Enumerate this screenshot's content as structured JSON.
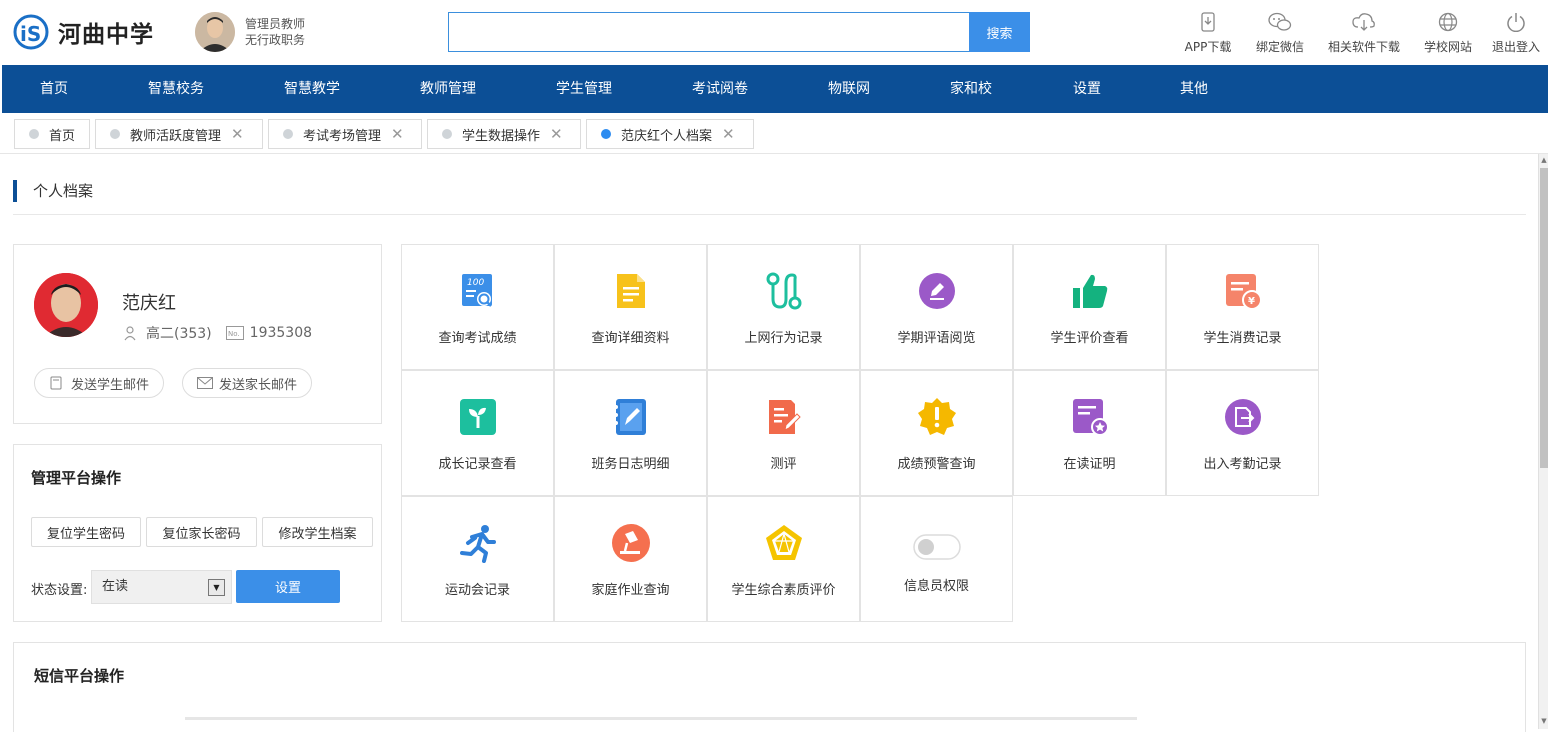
{
  "header": {
    "school_name": "河曲中学",
    "user_role": "管理员教师",
    "user_position": "无行政职务",
    "search_placeholder": "",
    "search_button": "搜索",
    "tools": [
      {
        "label": "APP下载",
        "icon": "phone-download-icon"
      },
      {
        "label": "绑定微信",
        "icon": "wechat-icon"
      },
      {
        "label": "相关软件下载",
        "icon": "cloud-download-icon"
      },
      {
        "label": "学校网站",
        "icon": "globe-icon"
      },
      {
        "label": "退出登入",
        "icon": "power-icon"
      }
    ]
  },
  "nav": [
    "首页",
    "智慧校务",
    "智慧教学",
    "教师管理",
    "学生管理",
    "考试阅卷",
    "物联网",
    "家和校",
    "设置",
    "其他"
  ],
  "tabs": [
    {
      "label": "首页",
      "closable": false,
      "active": false
    },
    {
      "label": "教师活跃度管理",
      "closable": true,
      "active": false
    },
    {
      "label": "考试考场管理",
      "closable": true,
      "active": false
    },
    {
      "label": "学生数据操作",
      "closable": true,
      "active": false
    },
    {
      "label": "范庆红个人档案",
      "closable": true,
      "active": true
    }
  ],
  "section_title": "个人档案",
  "profile": {
    "name": "范庆红",
    "class": "高二(353)",
    "number": "1935308",
    "send_student_mail": "发送学生邮件",
    "send_parent_mail": "发送家长邮件"
  },
  "management": {
    "title": "管理平台操作",
    "reset_student_pwd": "复位学生密码",
    "reset_parent_pwd": "复位家长密码",
    "edit_student_file": "修改学生档案",
    "status_label": "状态设置:",
    "status_value": "在读",
    "set_button": "设置"
  },
  "functions": [
    {
      "label": "查询考试成绩",
      "icon": "exam-score-icon",
      "color": "#3b8fe8"
    },
    {
      "label": "查询详细资料",
      "icon": "document-icon",
      "color": "#f7c21b"
    },
    {
      "label": "上网行为记录",
      "icon": "route-icon",
      "color": "#1dbf9e"
    },
    {
      "label": "学期评语阅览",
      "icon": "edit-circle-icon",
      "color": "#9b59c8"
    },
    {
      "label": "学生评价查看",
      "icon": "thumbs-up-icon",
      "color": "#14b27f"
    },
    {
      "label": "学生消费记录",
      "icon": "bill-icon",
      "color": "#f5846a"
    },
    {
      "label": "成长记录查看",
      "icon": "sprout-icon",
      "color": "#1dbf9e"
    },
    {
      "label": "班务日志明细",
      "icon": "notebook-icon",
      "color": "#2f7fd8"
    },
    {
      "label": "测评",
      "icon": "test-edit-icon",
      "color": "#f16a4b"
    },
    {
      "label": "成绩预警查询",
      "icon": "warning-badge-icon",
      "color": "#f5b800"
    },
    {
      "label": "在读证明",
      "icon": "certificate-icon",
      "color": "#9b59c8"
    },
    {
      "label": "出入考勤记录",
      "icon": "attendance-icon",
      "color": "#9b59c8"
    },
    {
      "label": "运动会记录",
      "icon": "runner-icon",
      "color": "#2f7fd8"
    },
    {
      "label": "家庭作业查询",
      "icon": "desk-lamp-icon",
      "color": "#f5704f"
    },
    {
      "label": "学生综合素质评价",
      "icon": "pentagon-icon",
      "color": "#f5c400"
    },
    {
      "label": "信息员权限",
      "icon": "toggle-icon",
      "color": "#cccccc"
    }
  ],
  "sms": {
    "title": "短信平台操作"
  }
}
